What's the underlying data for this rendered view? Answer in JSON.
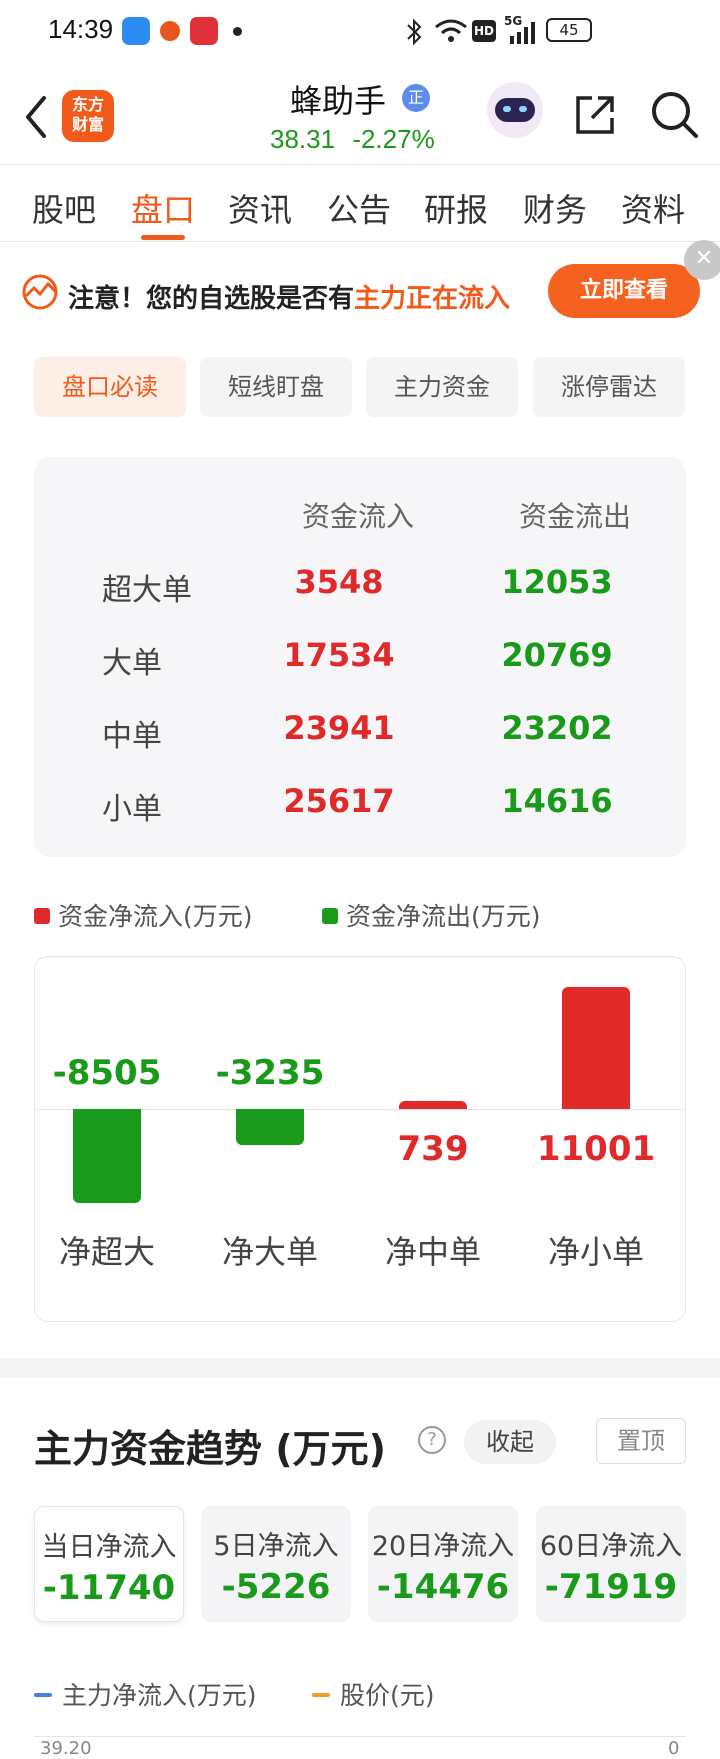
{
  "status_bar": {
    "time": "14:39",
    "battery": "45",
    "network": "5G"
  },
  "header": {
    "logo_line1": "东方",
    "logo_line2": "财富",
    "stock_name": "蜂助手",
    "badge": "正",
    "price": "38.31",
    "change": "-2.27%"
  },
  "tabs": [
    "股吧",
    "盘口",
    "资讯",
    "公告",
    "研报",
    "财务",
    "资料"
  ],
  "active_tab": "盘口",
  "notice": {
    "prefix": "注意！您的自选股是否有",
    "highlight": "主力正在流入",
    "button": "立即查看"
  },
  "subtabs": [
    "盘口必读",
    "短线盯盘",
    "主力资金",
    "涨停雷达"
  ],
  "flow_table": {
    "headers": [
      "资金流入",
      "资金流出"
    ],
    "rows": [
      {
        "label": "超大单",
        "in": "3548",
        "out": "12053"
      },
      {
        "label": "大单",
        "in": "17534",
        "out": "20769"
      },
      {
        "label": "中单",
        "in": "23941",
        "out": "23202"
      },
      {
        "label": "小单",
        "in": "25617",
        "out": "14616"
      }
    ]
  },
  "legend": {
    "inflow": "资金净流入(万元)",
    "outflow": "资金净流出(万元)"
  },
  "colors": {
    "accent": "#f25a1b",
    "red": "#e02a2a",
    "green": "#1a9a1a"
  },
  "chart_data": {
    "type": "bar",
    "categories": [
      "净超大",
      "净大单",
      "净中单",
      "净小单"
    ],
    "values": [
      -8505,
      -3235,
      739,
      11001
    ],
    "value_labels": [
      "-8505",
      "-3235",
      "739",
      "11001"
    ]
  },
  "trend": {
    "title": "主力资金趋势 (万元)",
    "collapse_label": "收起",
    "pin_label": "置顶",
    "cards": [
      {
        "label": "当日净流入",
        "value": "-11740"
      },
      {
        "label": "5日净流入",
        "value": "-5226"
      },
      {
        "label": "20日净流入",
        "value": "-14476"
      },
      {
        "label": "60日净流入",
        "value": "-71919"
      }
    ],
    "legend_flow": "主力净流入(万元)",
    "legend_price": "股价(元)",
    "y_left_top": "39.20",
    "y_right_top": "0"
  }
}
